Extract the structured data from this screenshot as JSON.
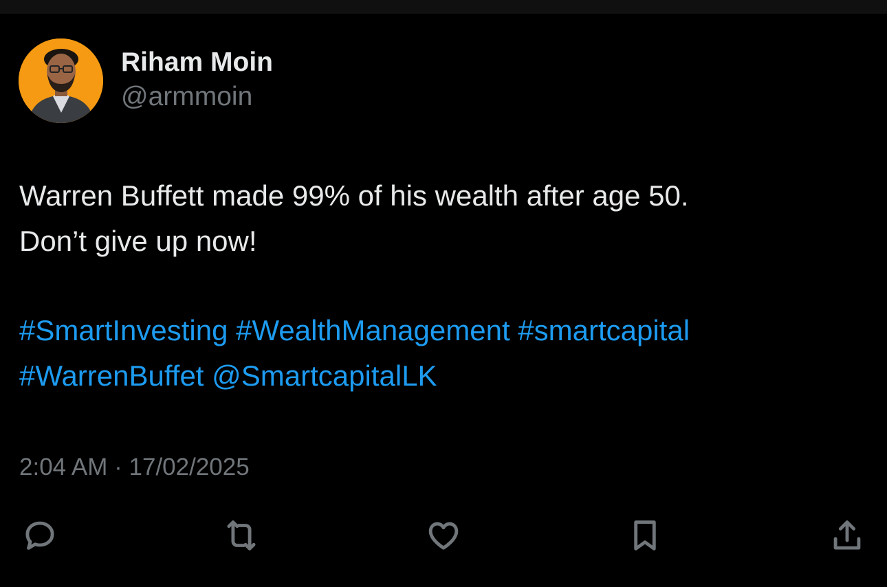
{
  "author": {
    "display_name": "Riham Moin",
    "handle": "@armmoin"
  },
  "tweet": {
    "text_lines": [
      "Warren Buffett made 99% of his wealth after age 50.",
      "Don’t give up now!"
    ],
    "links": [
      "#SmartInvesting",
      "#WealthManagement",
      "#smartcapital",
      "#WarrenBuffet",
      "@SmartcapitalLK"
    ],
    "timestamp": "2:04 AM · 17/02/2025"
  },
  "actions": {
    "icons": [
      "reply-icon",
      "retweet-icon",
      "like-icon",
      "bookmark-icon",
      "share-icon"
    ]
  },
  "colors": {
    "background": "#000000",
    "text_primary": "#e7e9ea",
    "text_secondary": "#71767b",
    "link": "#1d9bf0",
    "avatar_background": "#f59a12"
  }
}
